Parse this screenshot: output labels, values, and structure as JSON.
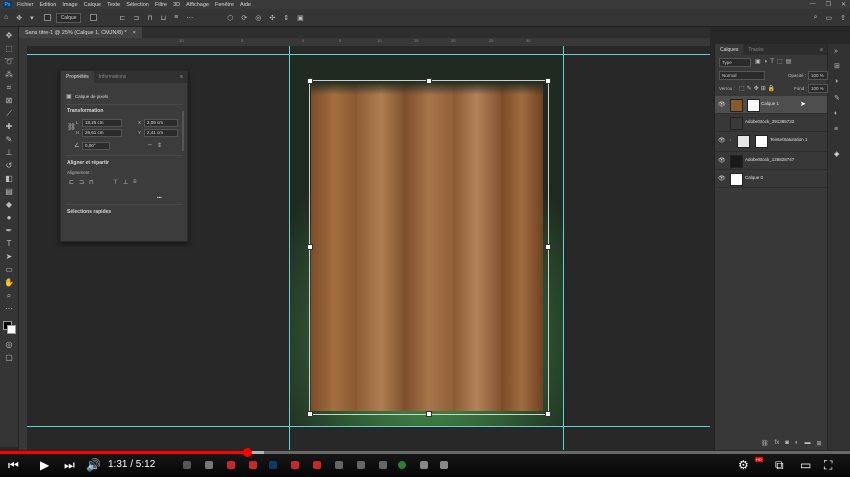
{
  "app": {
    "logo": "Ps"
  },
  "menu": [
    "Fichier",
    "Edition",
    "Image",
    "Calque",
    "Texte",
    "Sélection",
    "Filtre",
    "3D",
    "Affichage",
    "Fenêtre",
    "Aide"
  ],
  "window_controls": [
    "—",
    "❐",
    "✕"
  ],
  "options_bar": {
    "auto_select_value": "Calque",
    "icons": [
      "move-tool-icon",
      "select-dropdown-icon",
      "align-icon",
      "distribute-icon",
      "3d-mode-icon",
      "search-icon",
      "workspace-icon"
    ]
  },
  "document_tab": {
    "title": "Sans titre-1 @ 25% (Calque 1, CMJN/8) *",
    "close": "×"
  },
  "ruler_top_ticks": [
    "10",
    "5",
    "0",
    "5",
    "10",
    "15",
    "20",
    "25",
    "30"
  ],
  "tools": [
    "move",
    "marquee",
    "lasso",
    "quick-select",
    "crop",
    "frame",
    "eyedropper",
    "healing",
    "brush",
    "clone",
    "history-brush",
    "eraser",
    "gradient",
    "blur",
    "dodge",
    "pen",
    "type",
    "path-select",
    "shape",
    "hand",
    "zoom",
    "more",
    "colors",
    "quick-mask",
    "screen-mode"
  ],
  "properties_panel": {
    "tabs": [
      "Propriétés",
      "Informations"
    ],
    "layer_type": "Calque de pixels",
    "transform_heading": "Transformation",
    "W_label": "L",
    "W_value": "18,25 cm",
    "H_label": "H",
    "H_value": "26,61 cm",
    "X_label": "X",
    "X_value": "2,09 cm",
    "Y_label": "Y",
    "Y_value": "2,41 cm",
    "angle_value": "0,00°",
    "align_heading": "Aligner et répartir",
    "align_sub": "Alignement :",
    "more": "•••",
    "quick_actions": "Sélections rapides"
  },
  "layers_panel": {
    "tabs": [
      "Calques",
      "Tracés"
    ],
    "filter_label": "Type",
    "blend_mode": "Normal",
    "opacity_label": "Opacité :",
    "opacity_value": "100 %",
    "lock_label": "Verrou :",
    "fill_label": "Fond :",
    "fill_value": "100 %",
    "layers": [
      {
        "name": "Calque 1",
        "selected": true,
        "thumb_color": "#8b5a2b",
        "has_mask": true
      },
      {
        "name": "AdobeStock_391385733",
        "selected": false,
        "thumb_color": "#3a3a3a",
        "has_mask": false
      },
      {
        "name": "Teinte/Saturation 1",
        "selected": false,
        "thumb_color": "#e6e6e6",
        "has_mask": true
      },
      {
        "name": "AdobeStock_128828747",
        "selected": false,
        "thumb_color": "#1a1a1a",
        "has_mask": false
      },
      {
        "name": "Calque 0",
        "selected": false,
        "thumb_color": "#ffffff",
        "has_mask": false
      }
    ],
    "bottom_icons": [
      "link-icon",
      "fx-icon",
      "mask-icon",
      "adjustment-icon",
      "group-icon",
      "new-layer-icon",
      "trash-icon"
    ]
  },
  "video": {
    "time": "1:31 / 5:12",
    "progress": 0.29,
    "buffered": 0.31,
    "hd_badge": "HD"
  },
  "colors": {
    "accent_red": "#ff0000",
    "guide": "#5fd3d3",
    "wood_dark": "#6b4325",
    "wood_light": "#a67548"
  }
}
